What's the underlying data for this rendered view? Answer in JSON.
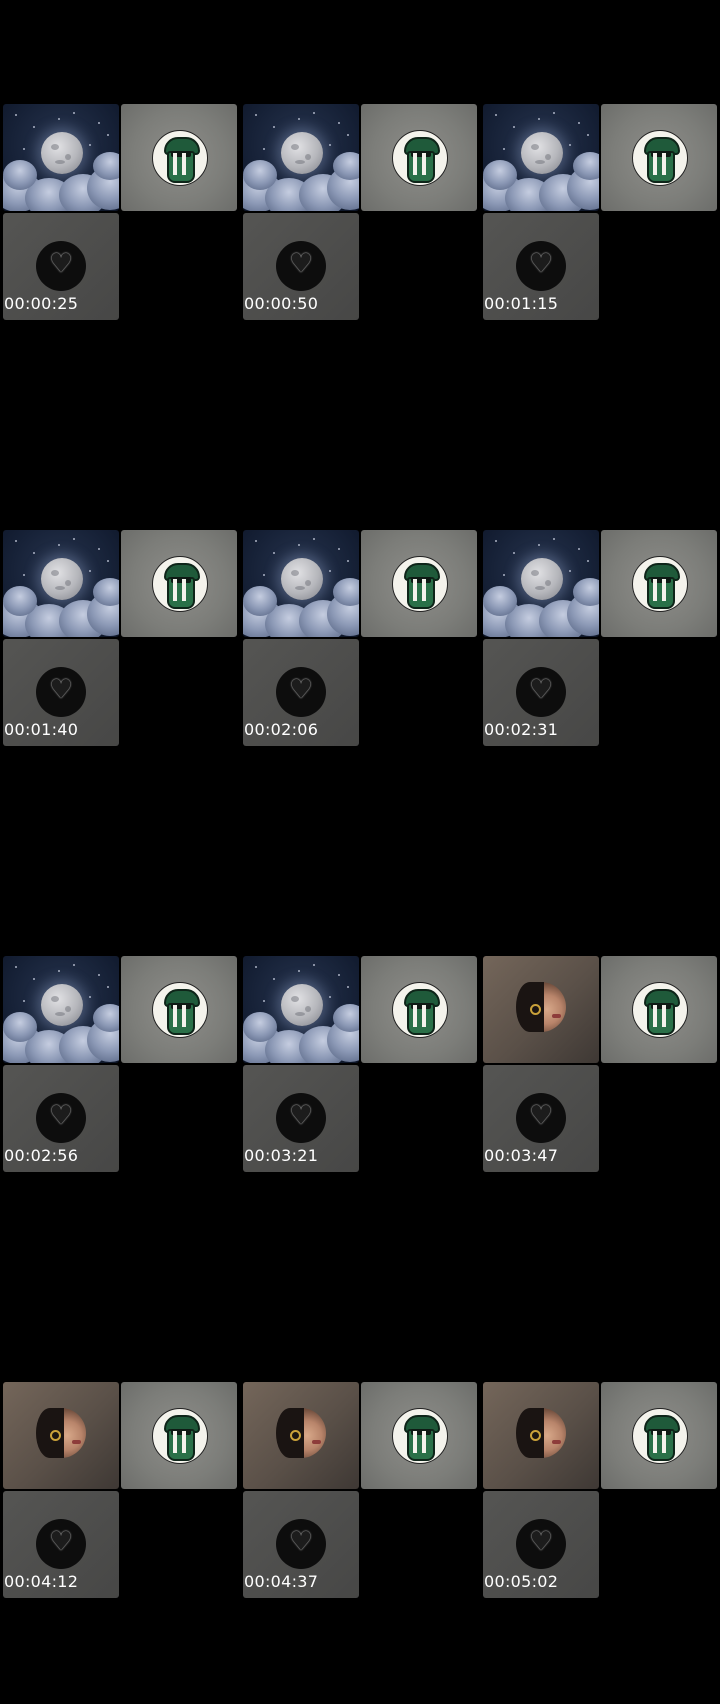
{
  "frames": [
    {
      "timestamp": "00:00:25",
      "top_tile": "moon"
    },
    {
      "timestamp": "00:00:50",
      "top_tile": "moon"
    },
    {
      "timestamp": "00:01:15",
      "top_tile": "moon"
    },
    {
      "timestamp": "00:01:40",
      "top_tile": "moon"
    },
    {
      "timestamp": "00:02:06",
      "top_tile": "moon"
    },
    {
      "timestamp": "00:02:31",
      "top_tile": "moon"
    },
    {
      "timestamp": "00:02:56",
      "top_tile": "moon"
    },
    {
      "timestamp": "00:03:21",
      "top_tile": "moon"
    },
    {
      "timestamp": "00:03:47",
      "top_tile": "portrait"
    },
    {
      "timestamp": "00:04:12",
      "top_tile": "portrait"
    },
    {
      "timestamp": "00:04:37",
      "top_tile": "portrait"
    },
    {
      "timestamp": "00:05:02",
      "top_tile": "portrait"
    }
  ],
  "tiles": {
    "moon": {
      "icon": "moon-clouds-thumbnail"
    },
    "portrait": {
      "icon": "portrait-thumbnail"
    },
    "logo": {
      "icon": "green-robot-logo"
    },
    "heart": {
      "icon": "heart-icon",
      "glyph": "♥"
    }
  },
  "colors": {
    "background": "#000000",
    "timestamp_text": "#ffffff",
    "logo_green": "#2a7048"
  }
}
